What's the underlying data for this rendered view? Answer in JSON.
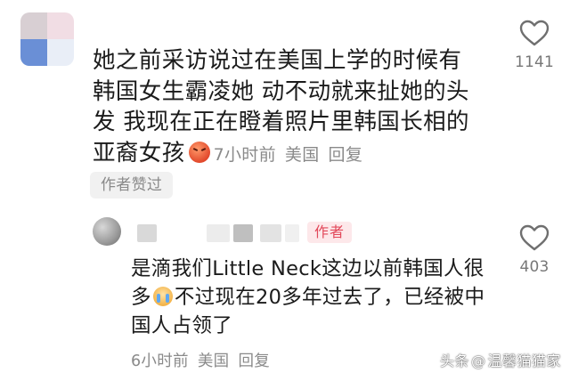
{
  "top_comment": {
    "text": "她之前采访说过在美国上学的时候有韩国女生霸凌她 动不动就来扯她的头发 我现在正在瞪着照片里韩国长相的亚裔女孩",
    "time": "7小时前",
    "location": "美国",
    "reply_label": "回复",
    "liked_badge": "作者赞过",
    "like_count": "1141"
  },
  "reply": {
    "author_tag": "作者",
    "text_before_emoji": "是滴我们Little Neck这边以前韩国人很多",
    "text_after_emoji": "不过现在20多年过去了，已经被中国人占领了",
    "time": "6小时前",
    "location": "美国",
    "reply_label": "回复",
    "like_count": "403"
  },
  "watermark": {
    "platform": "头条",
    "at": "@",
    "account": "温馨猫猫家"
  },
  "icons": {
    "like": "heart-outline-icon",
    "angry_emoji": "angry-face-emoji",
    "cry_emoji": "crying-face-emoji"
  },
  "colors": {
    "text": "#1b1b1b",
    "meta": "#8a8a8a",
    "author_tag_bg": "#fde8ea",
    "author_tag_text": "#e2485a"
  }
}
